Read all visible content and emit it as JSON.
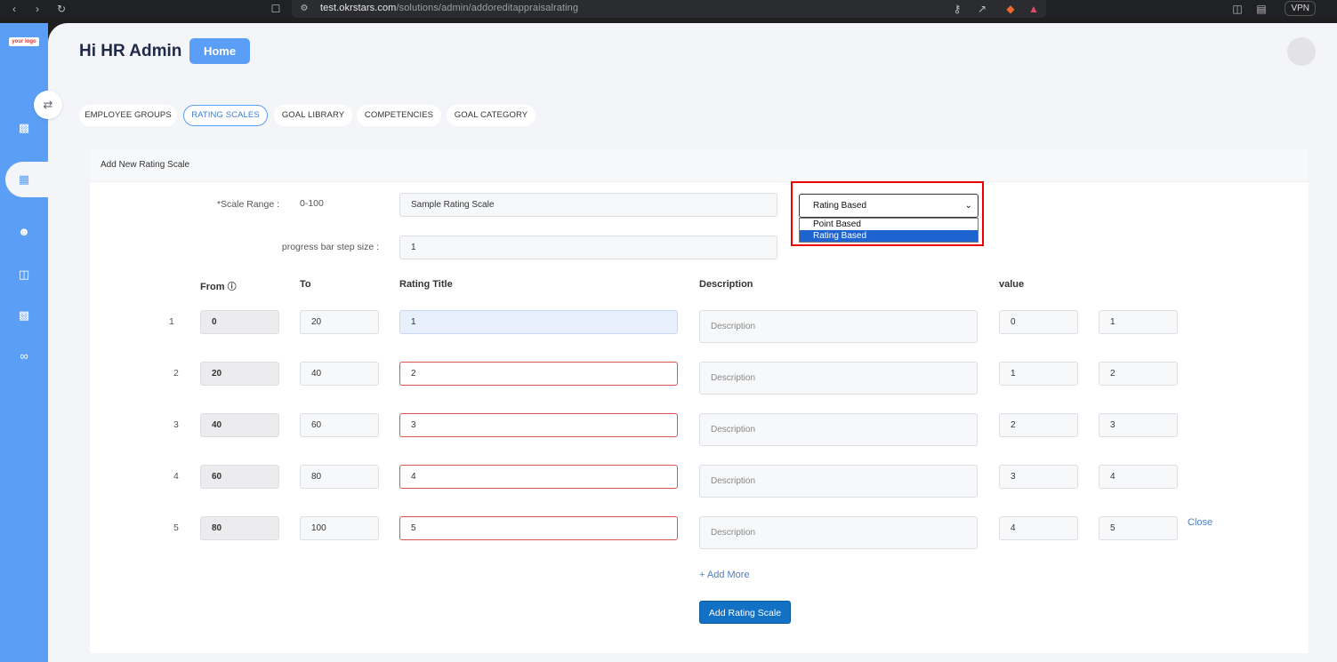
{
  "browser": {
    "url_host": "test.okrstars.com",
    "url_path": "/solutions/admin/addoreditappraisalrating",
    "vpn_label": "VPN"
  },
  "sidebar": {
    "logo_text": "your logo",
    "icons": [
      "bar-chart-icon",
      "grid-icon",
      "people-icon",
      "columns-icon",
      "bar-chart-icon",
      "handshake-icon"
    ]
  },
  "header": {
    "greeting": "Hi HR Admin",
    "home_label": "Home"
  },
  "tabs": [
    {
      "label": "EMPLOYEE GROUPS"
    },
    {
      "label": "RATING SCALES",
      "active": true
    },
    {
      "label": "GOAL LIBRARY"
    },
    {
      "label": "COMPETENCIES"
    },
    {
      "label": "GOAL CATEGORY"
    }
  ],
  "form": {
    "card_title": "Add New Rating Scale",
    "scale_range_label": "*Scale Range :",
    "scale_range_value": "0-100",
    "scale_name_value": "Sample Rating Scale",
    "step_size_label": "progress bar step size :",
    "step_size_value": "1",
    "scale_type": {
      "selected": "Rating Based",
      "options": [
        "Point Based",
        "Rating Based"
      ]
    },
    "columns": {
      "from": "From",
      "to": "To",
      "rating_title": "Rating Title",
      "description": "Description",
      "value": "value"
    },
    "description_placeholder": "Description",
    "rows": [
      {
        "num": "1",
        "from": "0",
        "to": "20",
        "title": "1",
        "v1": "0",
        "v2": "1"
      },
      {
        "num": "2",
        "from": "20",
        "to": "40",
        "title": "2",
        "v1": "1",
        "v2": "2"
      },
      {
        "num": "3",
        "from": "40",
        "to": "60",
        "title": "3",
        "v1": "2",
        "v2": "3"
      },
      {
        "num": "4",
        "from": "60",
        "to": "80",
        "title": "4",
        "v1": "3",
        "v2": "4"
      },
      {
        "num": "5",
        "from": "80",
        "to": "100",
        "title": "5",
        "v1": "4",
        "v2": "5"
      }
    ],
    "close_label": "Close",
    "add_more_label": "+ Add More",
    "submit_label": "Add Rating Scale"
  }
}
